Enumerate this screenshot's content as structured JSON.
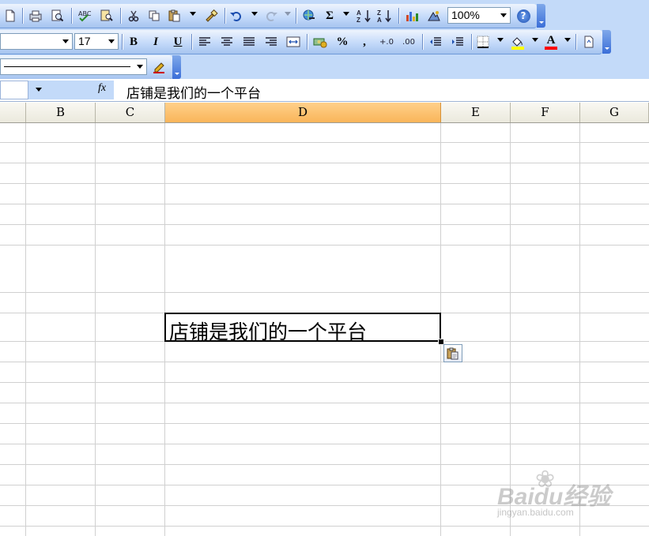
{
  "toolbar_standard": {
    "zoom_value": "100%",
    "sum_label": "Σ",
    "sort_asc_label": "A↓Z",
    "sort_desc_label": "Z↓A",
    "help_label": "?"
  },
  "toolbar_formatting": {
    "font_name_value": "",
    "font_size_value": "17",
    "bold_label": "B",
    "italic_label": "I",
    "underline_label": "U",
    "percent_label": "%",
    "comma_label": ",",
    "increase_decimal_label": "+.0",
    "decrease_decimal_label": ".00",
    "font_color_label": "A",
    "fill_color": "#ffff00",
    "font_color": "#ff0000"
  },
  "formula_bar": {
    "name_box_value": "",
    "fx_label": "fx",
    "content": "店铺是我们的一个平台"
  },
  "columns": [
    {
      "label": "B",
      "active": false
    },
    {
      "label": "C",
      "active": false
    },
    {
      "label": "D",
      "active": true
    },
    {
      "label": "E",
      "active": false
    },
    {
      "label": "F",
      "active": false
    },
    {
      "label": "G",
      "active": false
    }
  ],
  "active_cell": {
    "column": "D",
    "text": "店铺是我们的一个平台"
  },
  "watermark": {
    "brand": "Baidu经验",
    "url": "jingyan.baidu.com"
  },
  "colors": {
    "active_column_header": "#f9b55a",
    "toolbar_background": "#c3daf9",
    "grid_line": "#d0d0d0"
  }
}
